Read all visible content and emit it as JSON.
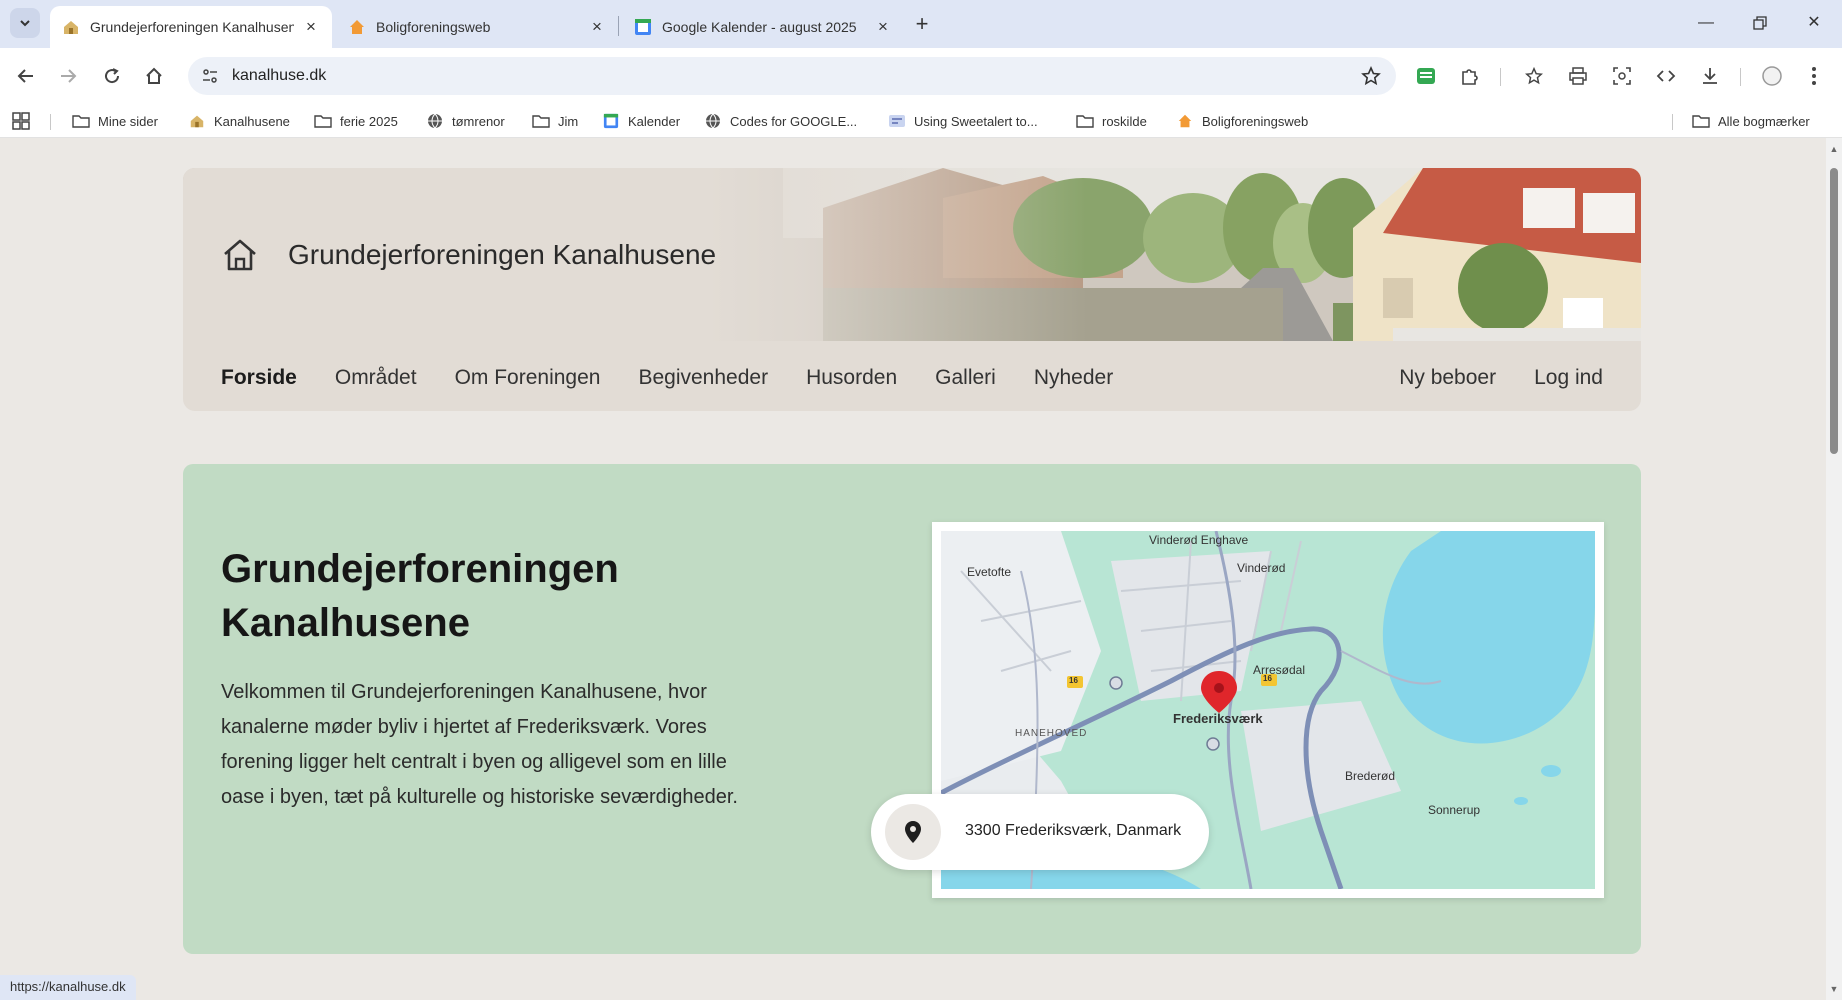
{
  "browser": {
    "tabs": [
      {
        "title": "Grundejerforeningen Kanalhusene",
        "active": true,
        "favicon": "house-logo-icon"
      },
      {
        "title": "Boligforeningsweb",
        "active": false,
        "favicon": "orange-house-icon"
      },
      {
        "title": "Google Kalender - august 2025",
        "active": false,
        "favicon": "google-calendar-icon"
      }
    ],
    "url": "kanalhuse.dk",
    "bookmarks": [
      {
        "label": "Mine sider",
        "icon": "folder-icon"
      },
      {
        "label": "Kanalhusene",
        "icon": "house-logo-icon"
      },
      {
        "label": "ferie 2025",
        "icon": "folder-icon"
      },
      {
        "label": "tømrenor",
        "icon": "globe-icon"
      },
      {
        "label": "Jim",
        "icon": "folder-icon"
      },
      {
        "label": "Kalender",
        "icon": "google-calendar-icon"
      },
      {
        "label": "Codes for GOOGLE...",
        "icon": "globe-icon"
      },
      {
        "label": "Using Sweetalert to...",
        "icon": "sweetalert-icon"
      },
      {
        "label": "roskilde",
        "icon": "folder-icon"
      },
      {
        "label": "Boligforeningsweb",
        "icon": "orange-house-icon"
      }
    ],
    "all_bookmarks": "Alle bogmærker",
    "status_url": "https://kanalhuse.dk"
  },
  "site": {
    "brand": "Grundejerforeningen Kanalhusene",
    "nav": [
      {
        "label": "Forside",
        "active": true
      },
      {
        "label": "Området",
        "active": false
      },
      {
        "label": "Om Foreningen",
        "active": false
      },
      {
        "label": "Begivenheder",
        "active": false
      },
      {
        "label": "Husorden",
        "active": false
      },
      {
        "label": "Galleri",
        "active": false
      },
      {
        "label": "Nyheder",
        "active": false
      }
    ],
    "side_nav": [
      {
        "label": "Ny beboer"
      },
      {
        "label": "Log ind"
      }
    ]
  },
  "hero": {
    "title": "Grundejerforeningen Kanalhusene",
    "text": "Velkommen til Grundejerforeningen Kanalhusene, hvor kanalerne møder byliv i hjertet af Frederiksværk. Vores forening ligger helt centralt i byen og alligevel som en lille oase i byen, tæt på kulturelle og historiske seværdigheder.",
    "map": {
      "labels": [
        "Vinderød Enghave",
        "Evetofte",
        "Vinderød",
        "Arresødal",
        "Frederiksværk",
        "HANEHOVED",
        "Brederød",
        "Sonnerup"
      ],
      "road_numbers": [
        "16",
        "16"
      ]
    },
    "address": "3300 Frederiksværk, Danmark"
  },
  "colors": {
    "page_bg": "#ebe8e4",
    "header_bg": "#e2dcd5",
    "hero_bg": "#c1dbc4",
    "map_land": "#b8e5d4",
    "map_water": "#86d6ea",
    "map_road": "#7e8fb6",
    "pin": "#e0262b"
  }
}
